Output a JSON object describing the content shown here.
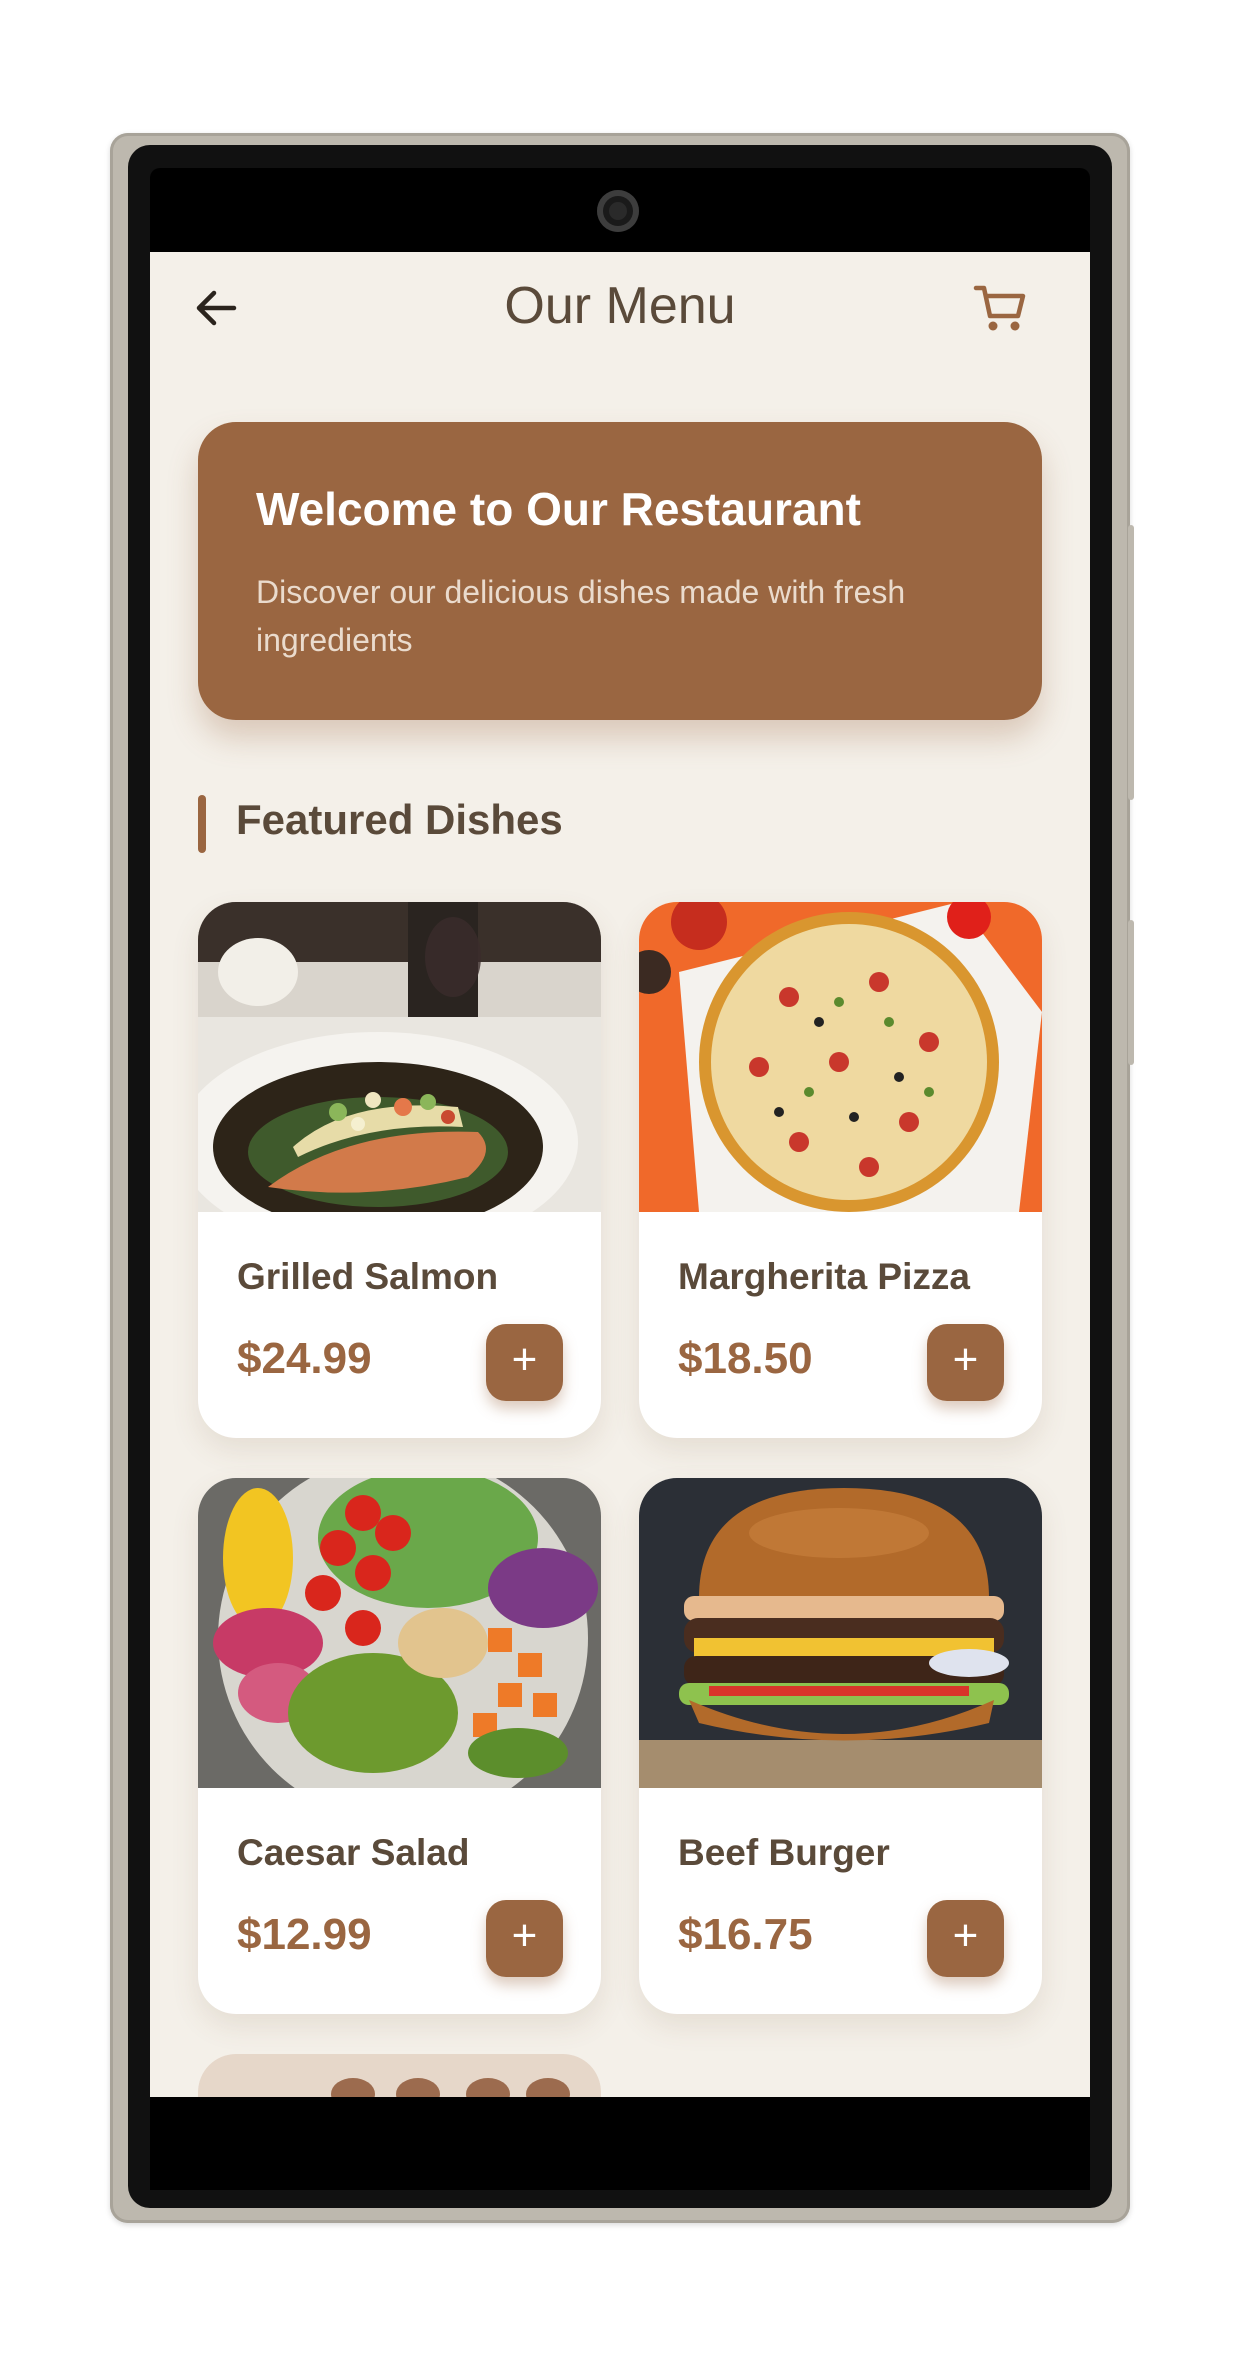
{
  "header": {
    "title": "Our Menu",
    "back_icon": "arrow-left-icon",
    "cart_icon": "shopping-cart-icon"
  },
  "banner": {
    "heading": "Welcome to Our Restaurant",
    "subtext": "Discover our delicious dishes made with fresh ingredients"
  },
  "section": {
    "title": "Featured Dishes"
  },
  "dishes": [
    {
      "name": "Grilled Salmon",
      "price": "$24.99",
      "image": "grilled-salmon-photo"
    },
    {
      "name": "Margherita Pizza",
      "price": "$18.50",
      "image": "pizza-photo"
    },
    {
      "name": "Caesar Salad",
      "price": "$12.99",
      "image": "salad-bowl-photo"
    },
    {
      "name": "Beef Burger",
      "price": "$16.75",
      "image": "burger-photo"
    }
  ],
  "add_label": "+",
  "colors": {
    "accent": "#9a6641",
    "background": "#f4f0e9",
    "text_dark": "#5a4a3a"
  }
}
